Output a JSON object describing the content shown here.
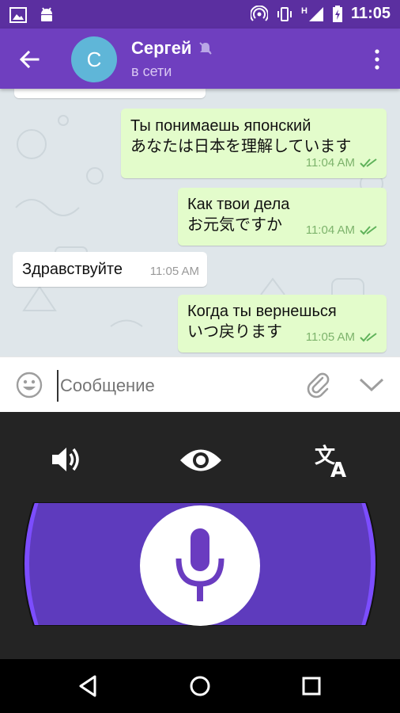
{
  "status_bar": {
    "time": "11:05",
    "network_label": "H",
    "icons": [
      "image-icon",
      "android-icon",
      "hotspot-icon",
      "vibrate-icon",
      "signal-icon",
      "battery-charging-icon"
    ]
  },
  "header": {
    "avatar_letter": "С",
    "contact_name": "Сергей",
    "status": "в сети",
    "muted_icon": "muted-icon"
  },
  "messages": [
    {
      "direction": "out",
      "lines": [
        "Ты понимаешь японский",
        "あなたは日本を理解しています"
      ],
      "time": "11:04 AM",
      "read": true
    },
    {
      "direction": "out",
      "lines": [
        "Как твои дела",
        "お元気ですか"
      ],
      "time": "11:04 AM",
      "read": true
    },
    {
      "direction": "in",
      "lines": [
        "Здравствуйте"
      ],
      "time": "11:05 AM"
    },
    {
      "direction": "out",
      "lines": [
        "Когда ты вернешься",
        "いつ戻ります"
      ],
      "time": "11:05 AM",
      "read": true
    }
  ],
  "input": {
    "placeholder": "Сообщение",
    "value": ""
  },
  "voice_panel": {
    "icons": [
      "speaker-icon",
      "eye-icon",
      "translate-icon",
      "microphone-icon"
    ]
  },
  "colors": {
    "status_bar": "#5b2fa0",
    "app_bar": "#6f3fbf",
    "outgoing_bubble": "#e3fccb",
    "incoming_bubble": "#ffffff",
    "voice_pill": "#5e3bbd",
    "voice_pill_edge": "#7c4dff"
  }
}
